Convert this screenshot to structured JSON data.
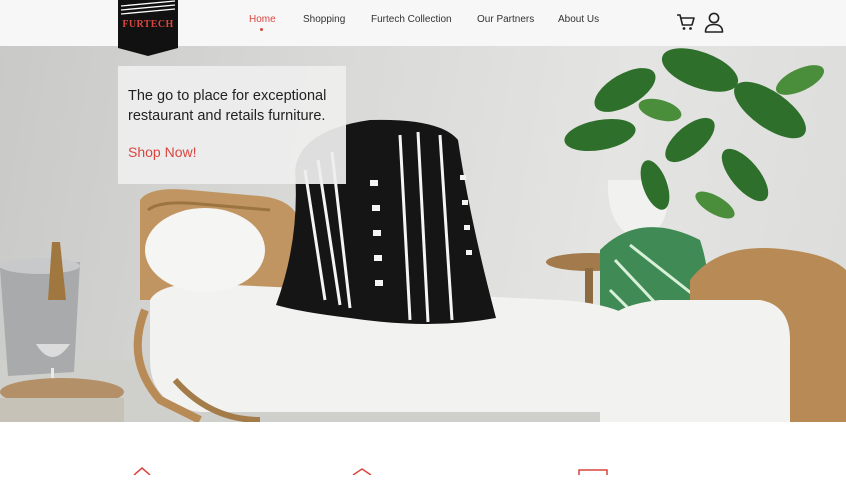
{
  "brand": {
    "logo_text": "FURTECH"
  },
  "nav": {
    "items": [
      {
        "label": "Home",
        "active": true
      },
      {
        "label": "Shopping"
      },
      {
        "label": "Furtech Collection"
      },
      {
        "label": "Our Partners"
      },
      {
        "label": "About Us"
      }
    ]
  },
  "hero": {
    "tagline": "The go to place for exceptional restaurant and retails furniture.",
    "cta": "Shop Now!"
  },
  "icons": {
    "cart": "cart-icon",
    "account": "user-icon",
    "features": [
      "house-icon",
      "box-icon",
      "card-icon"
    ]
  },
  "colors": {
    "accent": "#d9463f",
    "logo_bg": "#111111",
    "nav_bg": "#f7f7f7"
  }
}
